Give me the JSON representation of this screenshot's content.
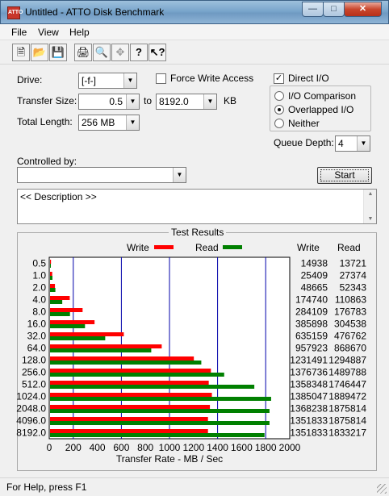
{
  "window": {
    "title": "Untitled - ATTO Disk Benchmark",
    "icon_text": "ATTO"
  },
  "menu": [
    "File",
    "View",
    "Help"
  ],
  "toolbar": [
    "new-icon",
    "open-icon",
    "save-icon",
    "print-icon",
    "print-preview-icon",
    "move-icon",
    "help-icon",
    "context-help-icon"
  ],
  "controls": {
    "drive_label": "Drive:",
    "drive_value": "[-f-]",
    "force_write_label": "Force Write Access",
    "force_write_checked": false,
    "direct_io_label": "Direct I/O",
    "direct_io_checked": true,
    "transfer_size_label": "Transfer Size:",
    "transfer_from": "0.5",
    "transfer_to_label": "to",
    "transfer_to": "8192.0",
    "transfer_unit": "KB",
    "total_length_label": "Total Length:",
    "total_length": "256 MB",
    "io_modes": [
      {
        "label": "I/O Comparison",
        "selected": false
      },
      {
        "label": "Overlapped I/O",
        "selected": true
      },
      {
        "label": "Neither",
        "selected": false
      }
    ],
    "queue_depth_label": "Queue Depth:",
    "queue_depth": "4",
    "controlled_by_label": "Controlled by:",
    "controlled_by_value": "",
    "start_label": "Start",
    "description": "<< Description >>"
  },
  "results": {
    "title": "Test Results",
    "legend_write": "Write",
    "legend_read": "Read",
    "col_write": "Write",
    "col_read": "Read",
    "write_color": "#ff0000",
    "read_color": "#008000",
    "grid_color": "#0000aa"
  },
  "chart_data": {
    "type": "bar",
    "orientation": "horizontal",
    "xlabel": "Transfer Rate - MB / Sec",
    "xlim": [
      0,
      2000
    ],
    "xticks": [
      "0",
      "200",
      "400",
      "600",
      "800",
      "1000",
      "1200",
      "1400",
      "1600",
      "1800",
      "2000"
    ],
    "categories": [
      "0.5",
      "1.0",
      "2.0",
      "4.0",
      "8.0",
      "16.0",
      "32.0",
      "64.0",
      "128.0",
      "256.0",
      "512.0",
      "1024.0",
      "2048.0",
      "4096.0",
      "8192.0"
    ],
    "series": [
      {
        "name": "Write",
        "values": [
          14938,
          25409,
          48665,
          174740,
          284109,
          385898,
          635159,
          957923,
          1231491,
          1376736,
          1358348,
          1385047,
          1368238,
          1351833,
          1351833
        ]
      },
      {
        "name": "Read",
        "values": [
          13721,
          27374,
          52343,
          110863,
          176783,
          304538,
          476762,
          868670,
          1294887,
          1489788,
          1746447,
          1889472,
          1875814,
          1875814,
          1833217
        ]
      }
    ]
  },
  "status": {
    "text": "For Help, press F1"
  }
}
